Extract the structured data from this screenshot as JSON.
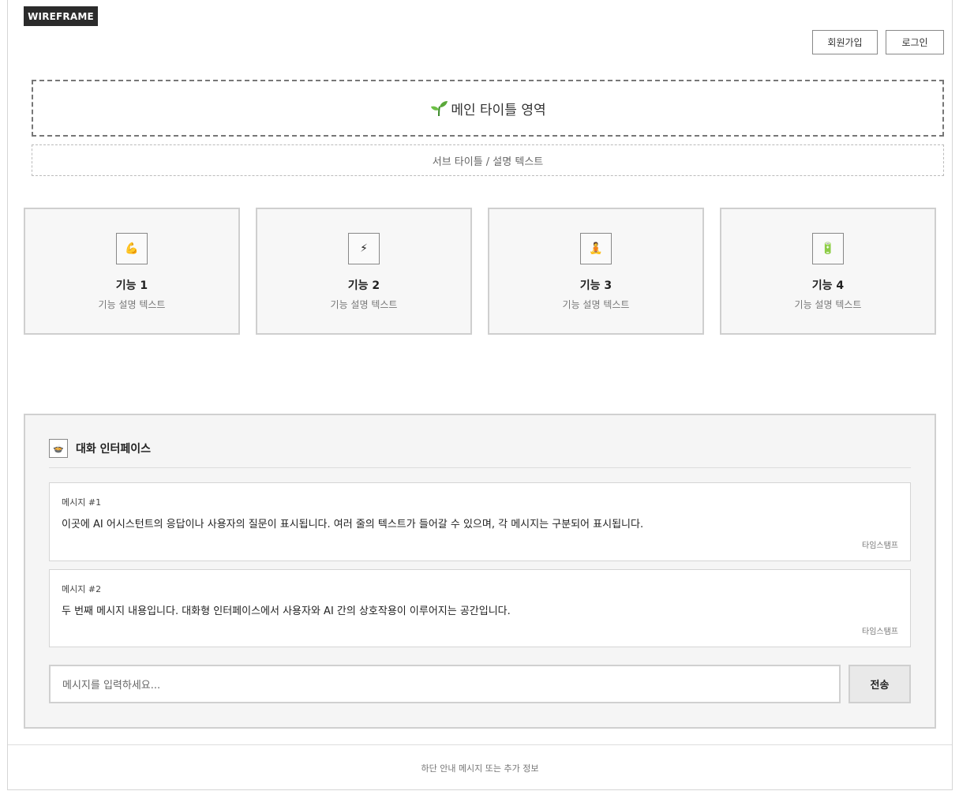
{
  "badge": "WIREFRAME",
  "header": {
    "signup_label": "회원가입",
    "login_label": "로그인"
  },
  "hero": {
    "title": "메인 타이틀 영역",
    "subtitle": "서브 타이틀 / 설명 텍스트",
    "title_icon": "sprout-icon"
  },
  "features": [
    {
      "icon": "💪",
      "icon_name": "flexed-biceps-icon",
      "title": "기능 1",
      "desc": "기능 설명 텍스트"
    },
    {
      "icon": "⚡",
      "icon_name": "lightning-icon",
      "title": "기능 2",
      "desc": "기능 설명 텍스트"
    },
    {
      "icon": "🧘",
      "icon_name": "meditation-icon",
      "title": "기능 3",
      "desc": "기능 설명 텍스트"
    },
    {
      "icon": "🔋",
      "icon_name": "battery-icon",
      "title": "기능 4",
      "desc": "기능 설명 텍스트"
    }
  ],
  "chat": {
    "icon": "🍲",
    "title": "대화 인터페이스",
    "messages": [
      {
        "label": "메시지 #1",
        "text": "이곳에 AI 어시스턴트의 응답이나 사용자의 질문이 표시됩니다. 여러 줄의 텍스트가 들어갈 수 있으며, 각 메시지는 구분되어 표시됩니다.",
        "timestamp": "타임스탬프"
      },
      {
        "label": "메시지 #2",
        "text": "두 번째 메시지 내용입니다. 대화형 인터페이스에서 사용자와 AI 간의 상호작용이 이루어지는 공간입니다.",
        "timestamp": "타임스탬프"
      }
    ],
    "input_placeholder": "메시지를 입력하세요...",
    "send_label": "전송"
  },
  "footer": {
    "text": "하단 안내 메시지 또는 추가 정보"
  },
  "colors": {
    "accent_dark": "#2b2b2b",
    "border": "#d0d0d0",
    "panel_bg": "#f5f5f5"
  }
}
